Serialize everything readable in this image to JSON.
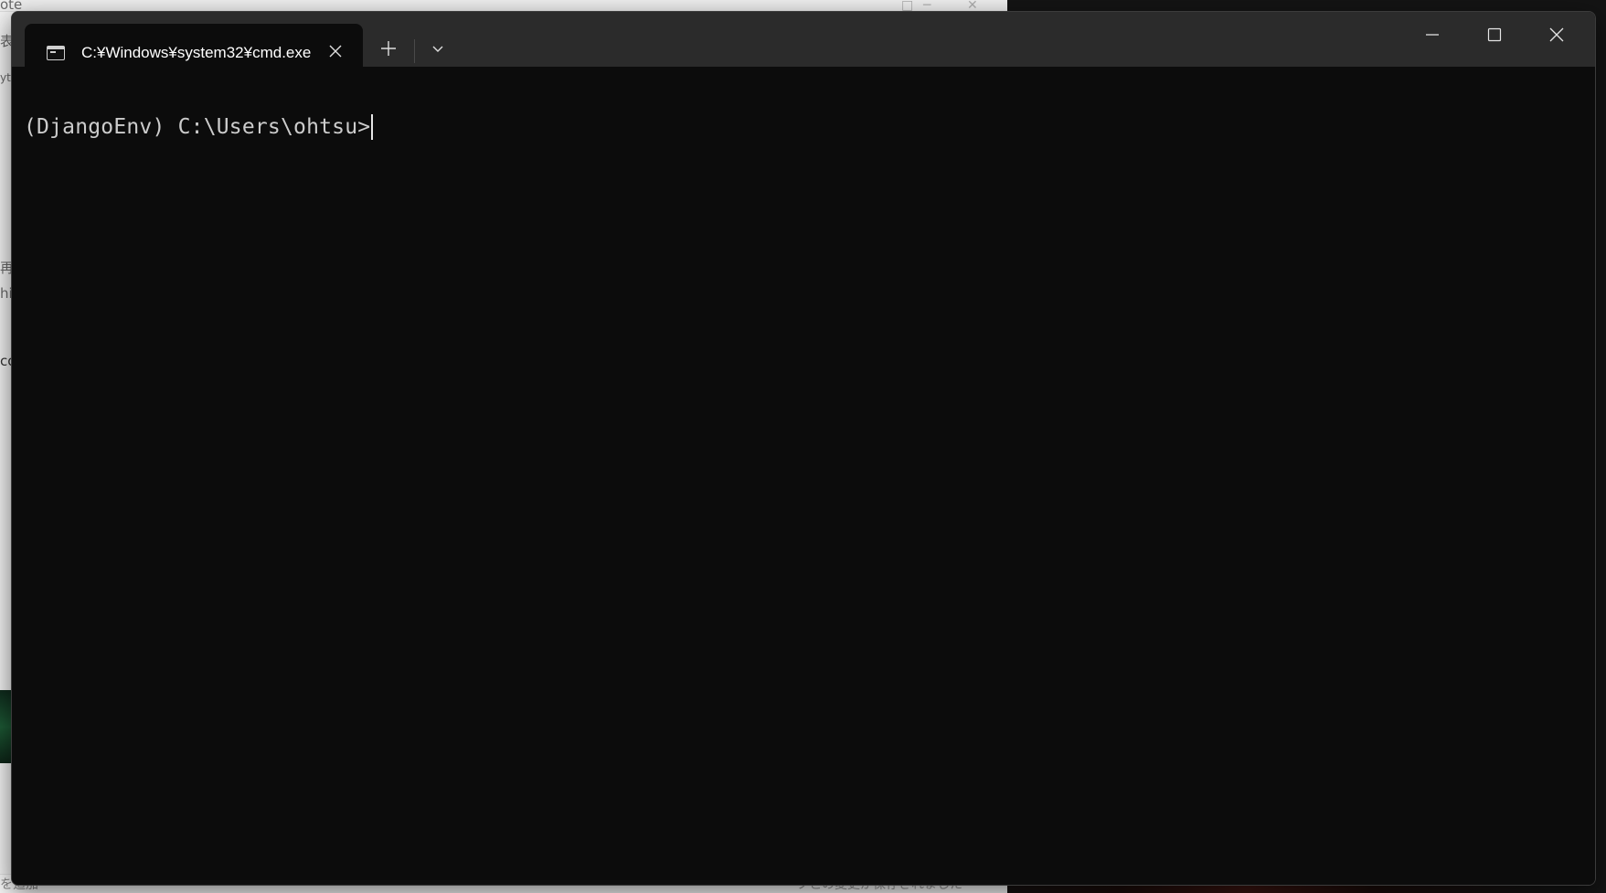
{
  "background": {
    "left_window": {
      "title_fragment": "ote",
      "side_fragments": [
        "表",
        "yt",
        "再",
        "hi",
        "co"
      ],
      "bottom_left_text": "を追加",
      "bottom_right_text": "ーブとの変更が保存されました"
    }
  },
  "terminal": {
    "tab": {
      "title": "C:¥Windows¥system32¥cmd.exe",
      "icon": "cmd-prompt-icon"
    },
    "prompt": {
      "env": "(DjangoEnv)",
      "path": "C:\\Users\\ohtsu>"
    }
  },
  "icons": {
    "tab_close": "close-icon",
    "new_tab": "plus-icon",
    "dropdown": "chevron-down-icon",
    "minimize": "minimize-icon",
    "maximize": "maximize-icon",
    "close": "close-icon"
  },
  "colors": {
    "terminal_bg": "#0c0c0c",
    "titlebar_bg": "#2b2b2b",
    "text": "#cccccc"
  }
}
